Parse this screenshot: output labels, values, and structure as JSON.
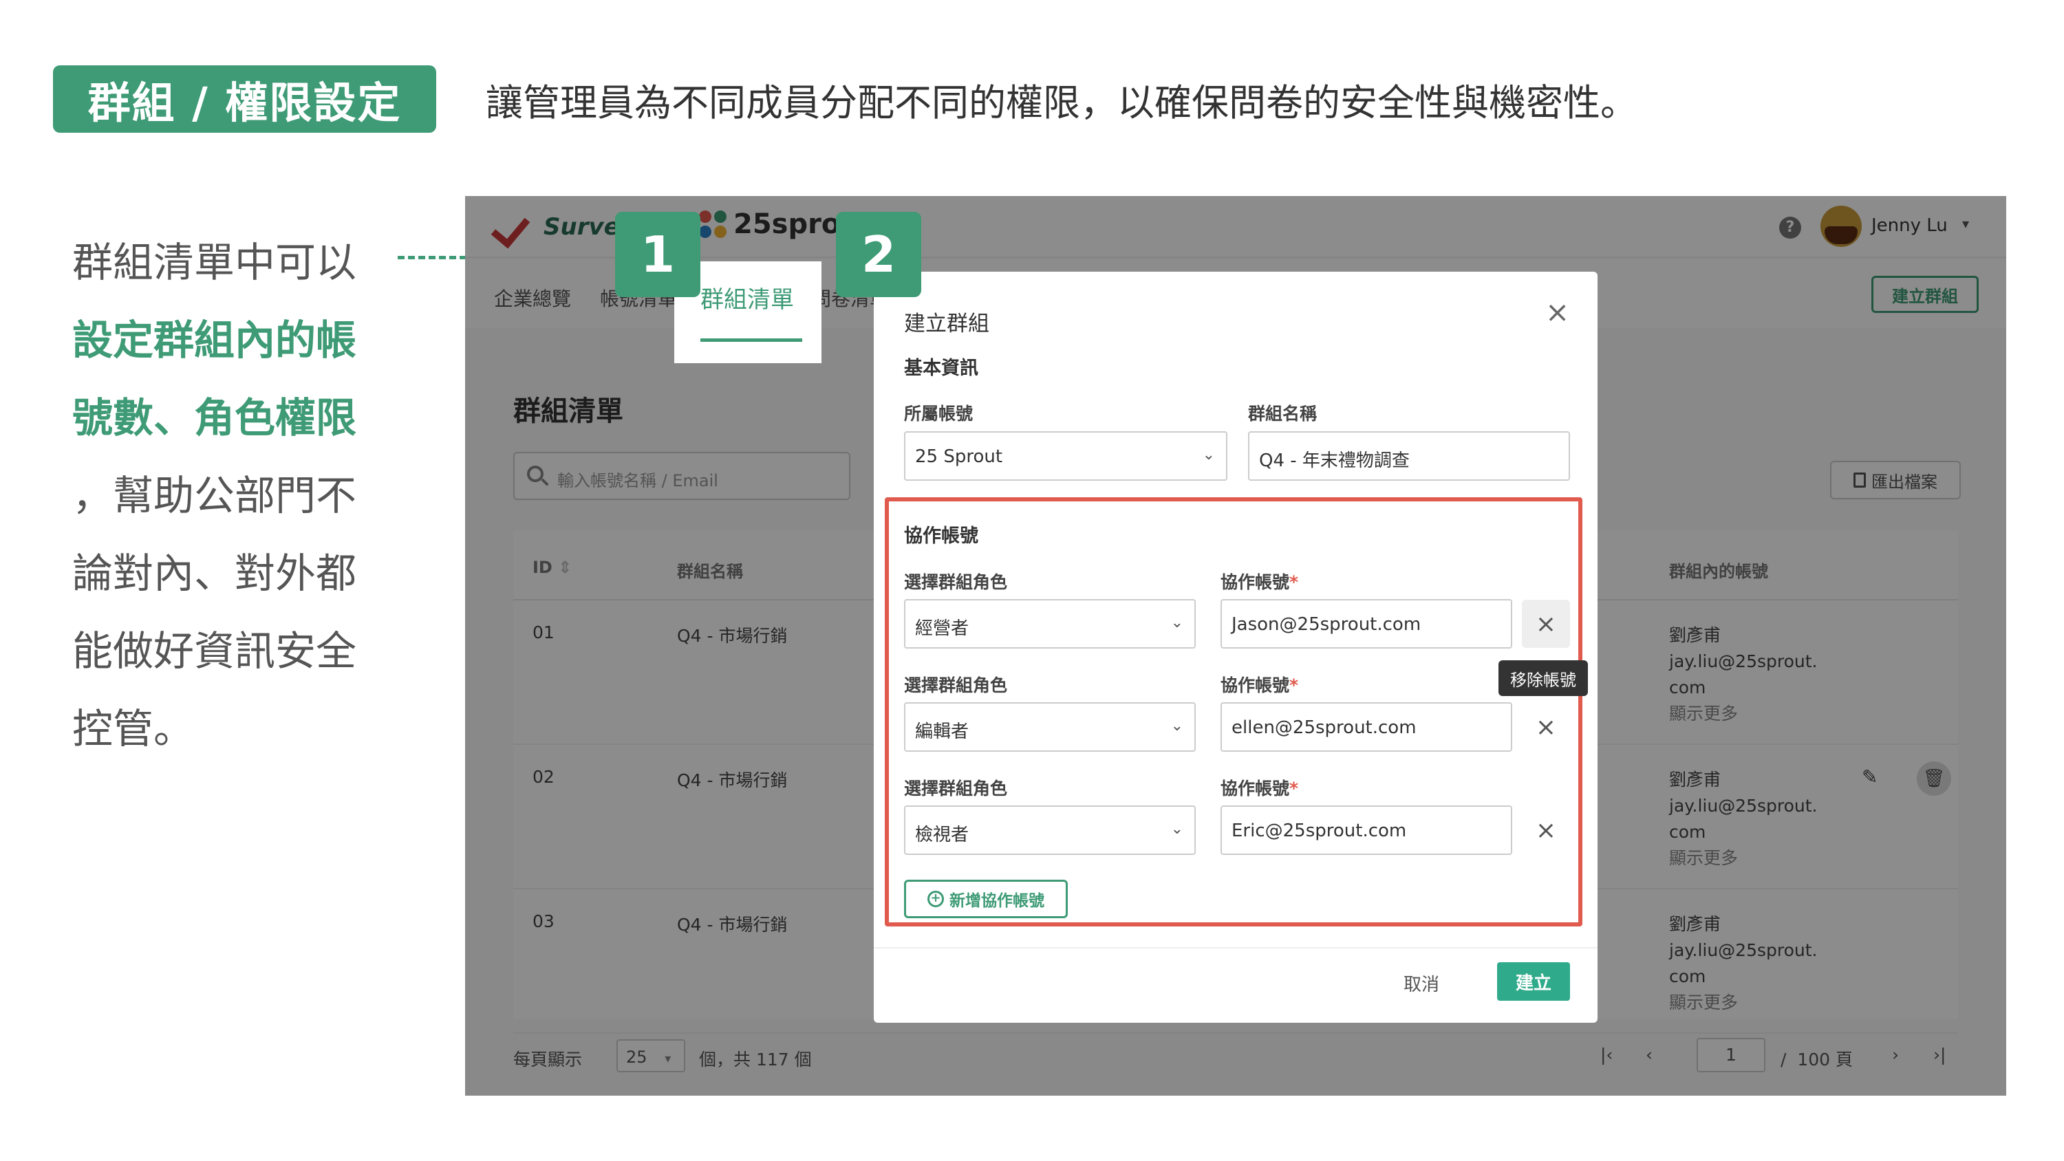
{
  "slide": {
    "title": "群組 / 權限設定",
    "subtitle": "讓管理員為不同成員分配不同的權限，以確保問卷的安全性與機密性。",
    "description": {
      "line1": "群組清單中可以",
      "highlight1": "設定群組內的帳",
      "highlight2": "號數、角色權限",
      "line2": "，幫助公部門不",
      "line3": "論對內、對外都",
      "line4": "能做好資訊安全",
      "line5": "控管。"
    },
    "badges": [
      "1",
      "2"
    ]
  },
  "app": {
    "logo_survey": "SurveyC",
    "logo_sprout": "25sprout",
    "sprout_colors": [
      "#e05a4e",
      "#3e9b76",
      "#2f80c6",
      "#f2b233"
    ],
    "user_name": "Jenny Lu",
    "nav_tabs": [
      "企業總覽",
      "帳號清單",
      "群組清單",
      "問卷清單"
    ],
    "create_group_label": "建立群組",
    "page_title": "群組清單",
    "search_placeholder": "輸入帳號名稱 / Email",
    "export_label": "匯出檔案",
    "table": {
      "headers": [
        "ID",
        "群組名稱",
        "群組內的帳號"
      ],
      "rows": [
        {
          "id": "01",
          "name": "Q4 - 市場行銷",
          "acc_name": "劉彥甫",
          "acc_email1": "jay.liu@25sprout.",
          "acc_email2": "com",
          "more": "顯示更多"
        },
        {
          "id": "02",
          "name": "Q4 - 市場行銷",
          "acc_name": "劉彥甫",
          "acc_email1": "jay.liu@25sprout.",
          "acc_email2": "com",
          "more": "顯示更多"
        },
        {
          "id": "03",
          "name": "Q4 - 市場行銷",
          "acc_name": "劉彥甫",
          "acc_email1": "jay.liu@25sprout.",
          "acc_email2": "com",
          "more": "顯示更多"
        }
      ]
    },
    "pagination": {
      "per_page_label": "每頁顯示",
      "per_page": "25",
      "total": "個，共 117 個",
      "current": "1",
      "total_pages": "/  100 頁"
    }
  },
  "modal": {
    "title": "建立群組",
    "section_basic": "基本資訊",
    "account_label": "所屬帳號",
    "account_value": "25 Sprout",
    "group_name_label": "群組名稱",
    "group_name_value": "Q4 - 年末禮物調查",
    "collab_section": "協作帳號",
    "role_label": "選擇群組角色",
    "collab_label": "協作帳號",
    "members": [
      {
        "role": "經營者",
        "email": "Jason@25sprout.com"
      },
      {
        "role": "編輯者",
        "email": "ellen@25sprout.com"
      },
      {
        "role": "檢視者",
        "email": "Eric@25sprout.com"
      }
    ],
    "remove_tooltip": "移除帳號",
    "add_collab": "新增協作帳號",
    "cancel": "取消",
    "create": "建立"
  }
}
